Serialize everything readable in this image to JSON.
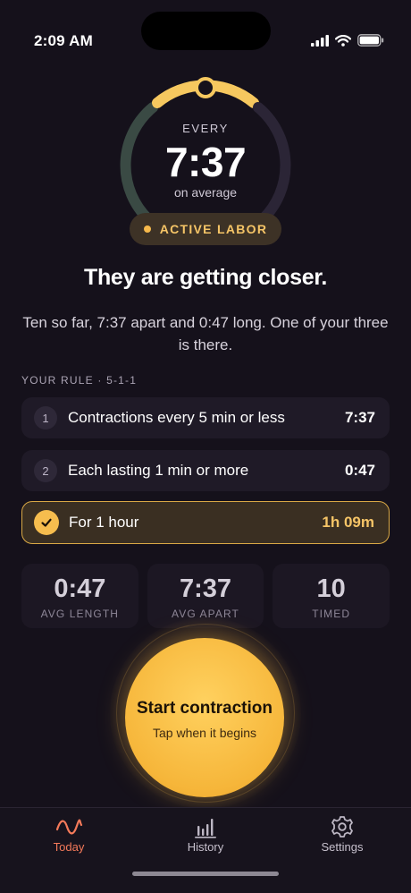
{
  "status": {
    "time": "2:09 AM"
  },
  "dial": {
    "every_label": "EVERY",
    "interval": "7:37",
    "sub_label": "on average"
  },
  "phase": {
    "label": "ACTIVE LABOR"
  },
  "headline": "They are getting closer.",
  "summary": "Ten so far, 7:37 apart and 0:47 long. One of your three is there.",
  "rule": {
    "label": "YOUR RULE · 5-1-1",
    "items": [
      {
        "number": "1",
        "text": "Contractions every 5 min or less",
        "value": "7:37",
        "met": false
      },
      {
        "number": "2",
        "text": "Each lasting 1 min or more",
        "value": "0:47",
        "met": false
      },
      {
        "number": "",
        "text": "For 1 hour",
        "value": "1h 09m",
        "met": true
      }
    ]
  },
  "stats": [
    {
      "value": "0:47",
      "label": "AVG LENGTH"
    },
    {
      "value": "7:37",
      "label": "AVG APART"
    },
    {
      "value": "10",
      "label": "TIMED"
    }
  ],
  "start": {
    "title": "Start contraction",
    "subtitle": "Tap when it begins"
  },
  "tabs": [
    {
      "label": "Today",
      "icon": "wave-icon",
      "active": true
    },
    {
      "label": "History",
      "icon": "bar-chart-icon",
      "active": false
    },
    {
      "label": "Settings",
      "icon": "gear-icon",
      "active": false
    }
  ],
  "colors": {
    "background": "#15111b",
    "accent": "#f6b94c",
    "active_tab": "#f57a5a",
    "dial_green": "#3a4a44",
    "dial_dark": "#2b2536"
  }
}
